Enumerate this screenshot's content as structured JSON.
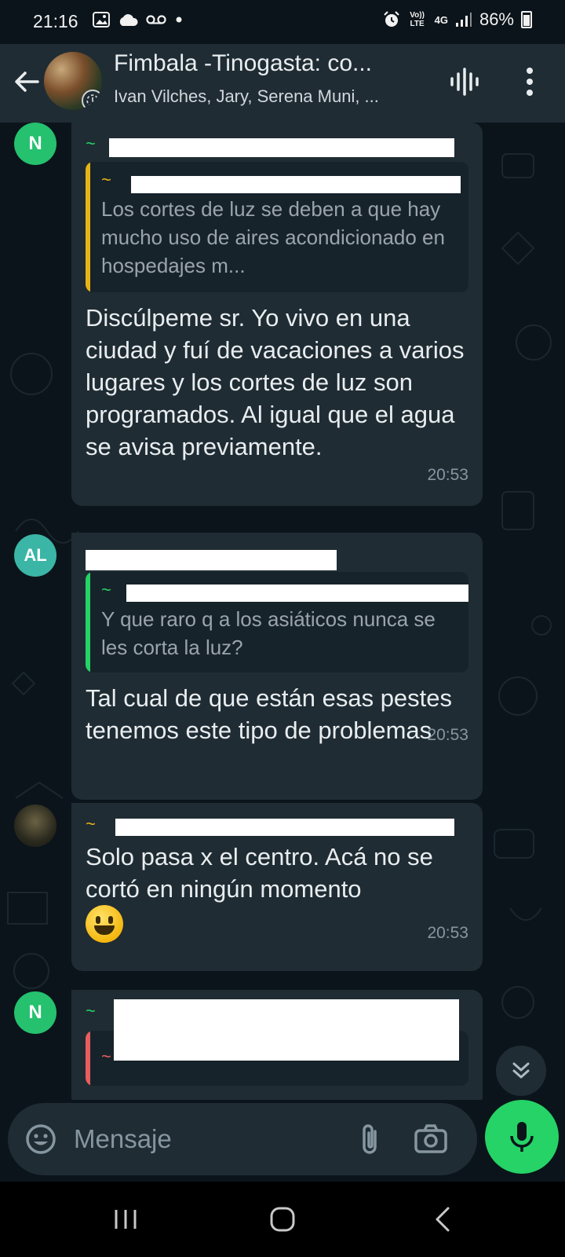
{
  "status_bar": {
    "time": "21:16",
    "left_icons": [
      "image-icon",
      "cloud-icon",
      "voicemail-icon",
      "dot-icon"
    ],
    "net_top": "Vo)) LTE",
    "net_gen": "4G",
    "battery": "86%"
  },
  "header": {
    "title": "Fimbala -Tinogasta: co...",
    "subtitle": "Ivan Vilches, Jary, Serena Muni, ..."
  },
  "messages": [
    {
      "avatar_text": "N",
      "quote_text": "Los cortes de luz se deben a que hay mucho uso de aires acondicionado en hospedajes m...",
      "text": "Discúlpeme sr. Yo vivo en una ciudad y fuí de vacaciones a varios lugares y los cortes de luz son programados. Al igual que el agua se avisa previamente.",
      "time": "20:53"
    },
    {
      "avatar_text": "AL",
      "quote_text": "Y que raro q a los asiáticos nunca se les corta la luz?",
      "text": "Tal cual de que están esas pestes tenemos este tipo de problemas",
      "time": "20:53"
    },
    {
      "avatar_text": "",
      "text": "Solo pasa x el centro.  Acá no se cortó en ningún momento",
      "emoji": "grinning-face-emoji",
      "time": "20:53"
    },
    {
      "avatar_text": "N"
    }
  ],
  "input": {
    "placeholder": "Mensaje"
  },
  "colors": {
    "background": "#0b141a",
    "bubble": "#1f2c34",
    "accent": "#25d366",
    "quote_gold": "#e7b416",
    "quote_red": "#e85e5e"
  }
}
